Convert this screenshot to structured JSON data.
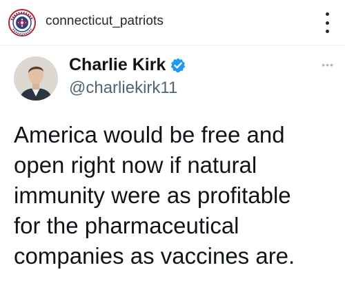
{
  "header": {
    "account_name": "connecticut_patriots",
    "logo_icon": "patriot-party-seal-icon",
    "more_icon": "vertical-ellipsis-icon"
  },
  "tweet": {
    "author_name": "Charlie Kirk",
    "author_handle": "@charliekirk11",
    "verified_icon": "verified-badge-icon",
    "more_icon": "horizontal-ellipsis-icon",
    "more_glyph": "•••",
    "text": "America would be free and\nopen right now if natural\nimmunity were as profitable\nfor the pharmaceutical\ncompanies as vaccines are."
  },
  "colors": {
    "verified_blue": "#1d9bf0",
    "seal_red": "#b22234",
    "seal_blue": "#2b3f8c"
  }
}
